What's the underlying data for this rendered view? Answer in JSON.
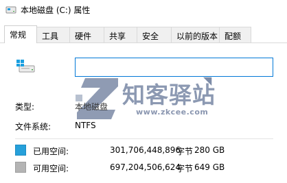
{
  "window": {
    "title": "本地磁盘 (C:) 属性",
    "icon": "drive-icon"
  },
  "tabs": [
    {
      "label": "常规",
      "active": true
    },
    {
      "label": "工具",
      "active": false
    },
    {
      "label": "硬件",
      "active": false
    },
    {
      "label": "共享",
      "active": false
    },
    {
      "label": "安全",
      "active": false
    },
    {
      "label": "以前的版本",
      "active": false
    },
    {
      "label": "配额",
      "active": false
    }
  ],
  "general": {
    "drive_name_value": "",
    "type_label": "类型:",
    "type_value": "本地磁盘",
    "filesystem_label": "文件系统:",
    "filesystem_value": "NTFS",
    "used": {
      "label": "已用空间:",
      "bytes": "301,706,448,896",
      "unit": "字节",
      "size": "280 GB",
      "color": "#26a0da"
    },
    "free": {
      "label": "可用空间:",
      "bytes": "697,204,506,624",
      "unit": "字节",
      "size": "649 GB",
      "color": "#b4b4b4"
    }
  },
  "watermark": {
    "title": "知客驿站",
    "url": "www.zkcee.com"
  }
}
